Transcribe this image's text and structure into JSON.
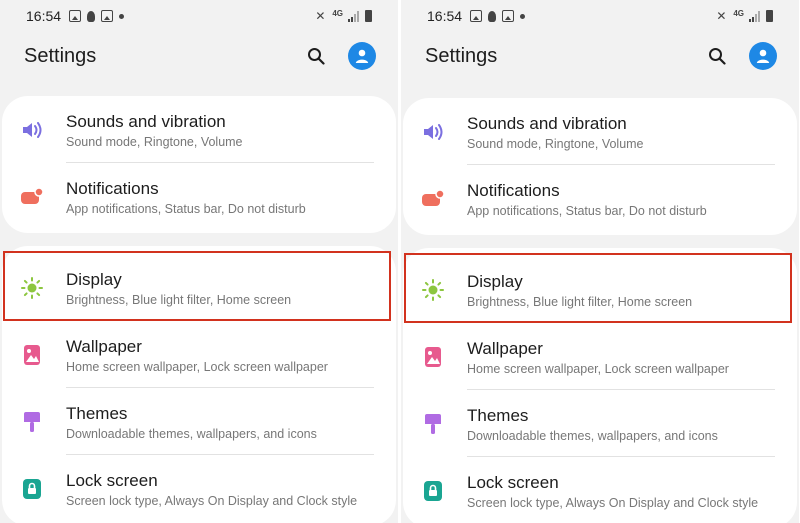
{
  "screens": [
    {
      "status": {
        "time": "16:54",
        "network": "4G"
      },
      "title": "Settings",
      "items": [
        {
          "label": "Sounds and vibration",
          "sublabel": "Sound mode, Ringtone, Volume"
        },
        {
          "label": "Notifications",
          "sublabel": "App notifications, Status bar, Do not disturb"
        },
        {
          "label": "Display",
          "sublabel": "Brightness, Blue light filter, Home screen"
        },
        {
          "label": "Wallpaper",
          "sublabel": "Home screen wallpaper, Lock screen wallpaper"
        },
        {
          "label": "Themes",
          "sublabel": "Downloadable themes, wallpapers, and icons"
        },
        {
          "label": "Lock screen",
          "sublabel": "Screen lock type, Always On Display and Clock style"
        }
      ]
    },
    {
      "status": {
        "time": "16:54",
        "network": "4G"
      },
      "title": "Settings",
      "items": [
        {
          "label": "Sounds and vibration",
          "sublabel": "Sound mode, Ringtone, Volume"
        },
        {
          "label": "Notifications",
          "sublabel": "App notifications, Status bar, Do not disturb"
        },
        {
          "label": "Display",
          "sublabel": "Brightness, Blue light filter, Home screen"
        },
        {
          "label": "Wallpaper",
          "sublabel": "Home screen wallpaper, Lock screen wallpaper"
        },
        {
          "label": "Themes",
          "sublabel": "Downloadable themes, wallpapers, and icons"
        },
        {
          "label": "Lock screen",
          "sublabel": "Screen lock type, Always On Display and Clock style"
        }
      ]
    }
  ],
  "icons": {
    "sounds": "volume-icon",
    "notifications": "notification-icon",
    "display": "brightness-icon",
    "wallpaper": "wallpaper-icon",
    "themes": "themes-brush-icon",
    "lock": "lock-icon"
  },
  "colors": {
    "highlight": "#d2321e",
    "sounds_icon": "#7b6fe0",
    "notifications_icon": "#ef6f5e",
    "display_icon": "#8cc63f",
    "wallpaper_icon": "#e75a8e",
    "themes_icon": "#b06be3",
    "lock_icon": "#1aa592",
    "avatar": "#1e88e5"
  }
}
